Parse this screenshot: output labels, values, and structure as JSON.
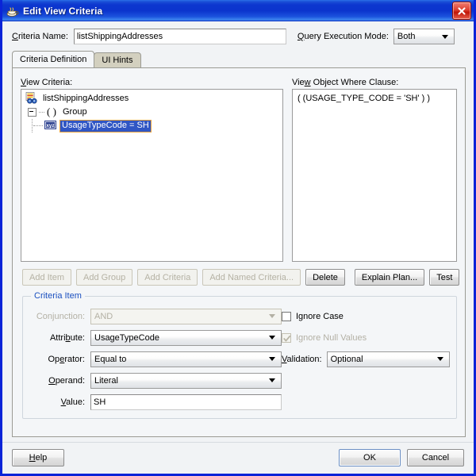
{
  "window": {
    "title": "Edit View Criteria",
    "app_icon": "coffee-cup-icon",
    "close_label": "×",
    "border_color": "#0a24d8",
    "titlebar_color": "#0b34cd"
  },
  "top": {
    "criteria_name_label": "Criteria Name:",
    "criteria_name_value": "listShippingAddresses",
    "criteria_name_placeholder": "",
    "query_execution_mode_label": "Query Execution Mode:",
    "query_execution_mode_value": "Both"
  },
  "tabs": [
    {
      "label": "Criteria Definition",
      "active": true
    },
    {
      "label": "UI Hints",
      "active": false
    }
  ],
  "view_criteria": {
    "label": "View Criteria:",
    "tree": [
      {
        "label": "listShippingAddresses",
        "icon": "view-criteria-icon",
        "level": 0,
        "selected": false
      },
      {
        "label": "Group",
        "icon": "group-parens-icon",
        "level": 1,
        "selected": false,
        "expanded": true
      },
      {
        "label": "UsageTypeCode = SH",
        "icon": "xyz-attribute-icon",
        "level": 2,
        "selected": true
      }
    ],
    "selection_bg": "#3056c4",
    "selection_border": "#e8a33d"
  },
  "where_clause": {
    "label": "View Object Where Clause:",
    "text": "( (USAGE_TYPE_CODE = 'SH' ) )"
  },
  "tree_buttons": [
    {
      "label": "Add Item",
      "enabled": false
    },
    {
      "label": "Add Group",
      "enabled": false
    },
    {
      "label": "Add Criteria",
      "enabled": false
    },
    {
      "label": "Add Named Criteria...",
      "enabled": false
    },
    {
      "label": "Delete",
      "enabled": true
    }
  ],
  "right_buttons": [
    {
      "label": "Explain Plan...",
      "enabled": true
    },
    {
      "label": "Test",
      "enabled": true
    }
  ],
  "criteria_item": {
    "legend": "Criteria Item",
    "legend_color": "#1a4fbf",
    "conjunction_label": "Conjunction:",
    "conjunction_value": "AND",
    "conjunction_enabled": false,
    "attribute_label": "Attribute:",
    "attribute_value": "UsageTypeCode",
    "operator_label": "Operator:",
    "operator_value": "Equal to",
    "operand_label": "Operand:",
    "operand_value": "Literal",
    "value_label": "Value:",
    "value_value": "SH",
    "ignore_case_label": "Ignore Case",
    "ignore_case_checked": false,
    "ignore_case_enabled": true,
    "ignore_null_label": "Ignore Null Values",
    "ignore_null_checked": true,
    "ignore_null_enabled": false,
    "validation_label": "Validation:",
    "validation_value": "Optional"
  },
  "footer": {
    "help_label": "Help",
    "ok_label": "OK",
    "cancel_label": "Cancel"
  }
}
